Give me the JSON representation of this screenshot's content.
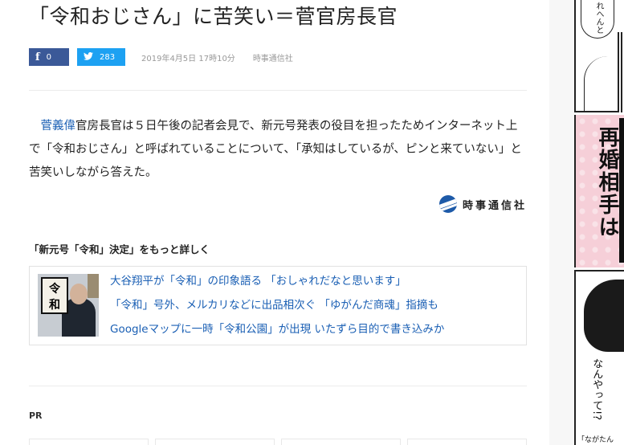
{
  "article": {
    "title": "「令和おじさん」に苦笑い＝菅官房長官",
    "share": {
      "facebook_icon": "f",
      "facebook_count": "0",
      "twitter_icon": "🐦",
      "twitter_count": "283"
    },
    "date": "2019年4月5日 17時10分",
    "source": "時事通信社",
    "body_link": "菅義偉",
    "body_text": "官房長官は５日午後の記者会見で、新元号発表の役目を担ったためインターネット上で「令和おじさん」と呼ばれていることについて、「承知はしているが、ピンと来ていない」と苦笑いしながら答えた。",
    "credit_name": "時事通信社"
  },
  "related": {
    "heading": "「新元号「令和」決定」をもっと詳しく",
    "thumb_char1": "令",
    "thumb_char2": "和",
    "links": [
      "大谷翔平が「令和」の印象語る 「おしゃれだなと思います」",
      "「令和」号外、メルカリなどに出品相次ぐ 「ゆがんだ商魂」指摘も",
      "Googleマップに一時「令和公園」が出現 いたずら目的で書き込みか"
    ]
  },
  "pr_label": "PR",
  "side_ad": {
    "bubble_text": "れへんと",
    "big_text": "再婚相手は",
    "speech": "なんやって!?",
    "caption": "「ながたん"
  },
  "colors": {
    "facebook": "#3b5998",
    "twitter": "#1da1f2",
    "link": "#1a5fb4",
    "ad_pink": "#f6cfd8"
  }
}
